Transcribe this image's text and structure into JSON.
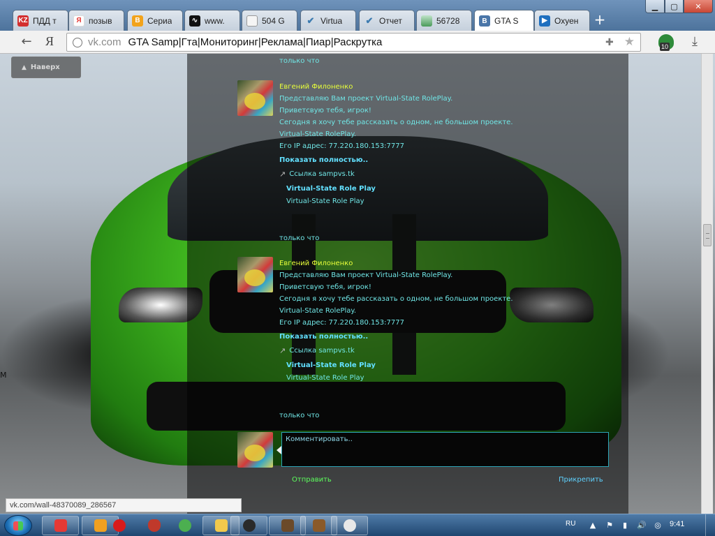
{
  "browser": {
    "tabs": [
      {
        "label": "ПДД т",
        "favicon": "kz-icon",
        "color": "#d32f2f"
      },
      {
        "label": "позыв",
        "favicon": "yandex-icon",
        "color": "#e53935"
      },
      {
        "label": "Сериа",
        "favicon": "b-icon",
        "color": "#f2a31b"
      },
      {
        "label": "www.",
        "favicon": "pulse-icon",
        "color": "#111111"
      },
      {
        "label": "504 G",
        "favicon": "page-icon",
        "color": "#9e9e9e"
      },
      {
        "label": "Virtua",
        "favicon": "v-check-icon",
        "color": "#3c7bb0"
      },
      {
        "label": "Отчет",
        "favicon": "v-check-icon",
        "color": "#3c7bb0"
      },
      {
        "label": "56728",
        "favicon": "image-icon",
        "color": "#4a9b5a"
      },
      {
        "label": "GTA S",
        "favicon": "vk-icon",
        "color": "#4a76a8",
        "active": true
      },
      {
        "label": "Охуен",
        "favicon": "play-icon",
        "color": "#1e6fbf"
      }
    ],
    "new_tab": "+",
    "address": {
      "domain": "vk.com",
      "title": "GTA Samp|Гта|Мониторинг|Реклама|Пиар|Раскрутка"
    },
    "extension_badge": "10",
    "status_url": "vk.com/wall-48370089_286567"
  },
  "page": {
    "scroll_top_label": "Наверх",
    "left_edge_char": "М",
    "posts": [
      {
        "author": "Евгений Филоненко",
        "lines": [
          "Представляю Вам проект Virtual-State RolePlay.",
          "Приветсвую тебя, игрок!",
          "Сегодня я хочу тебе рассказать о одном, не большом проекте.",
          "Virtual-State RolePlay.",
          "Его IP адрес: 77.220.180.153:7777"
        ],
        "show_more": "Показать полностью..",
        "link": "Ссылка sampvs.tk",
        "attachment_title": "Virtual-State Role Play",
        "attachment_sub": "Virtual-State Role Play",
        "timestamp": "только что"
      },
      {
        "author": "Евгений Филоненко",
        "lines": [
          "Представляю Вам проект Virtual-State RolePlay.",
          "Приветсвую тебя, игрок!",
          "Сегодня я хочу тебе рассказать о одном, не большом проекте.",
          "Virtual-State RolePlay.",
          "Его IP адрес: 77.220.180.153:7777"
        ],
        "show_more": "Показать полностью..",
        "link": "Ссылка sampvs.tk",
        "attachment_title": "Virtual-State Role Play",
        "attachment_sub": "Virtual-State Role Play",
        "timestamp": "только что"
      }
    ],
    "top_timestamp": "только что",
    "comment": {
      "placeholder": "Комментировать..",
      "send": "Отправить",
      "attach": "Прикрепить"
    }
  },
  "taskbar": {
    "apps": [
      {
        "name": "yandex-browser-icon",
        "color": "#e53935"
      },
      {
        "name": "media-player-icon",
        "color": "#f0a020"
      },
      {
        "name": "opera-icon",
        "color": "#d81b1b"
      },
      {
        "name": "money-bag-icon",
        "color": "#c0392b"
      },
      {
        "name": "icq-icon",
        "color": "#4caf50"
      },
      {
        "name": "explorer-icon",
        "color": "#f2c94c"
      },
      {
        "name": "steam-icon",
        "color": "#2a2a2a"
      },
      {
        "name": "game-icon",
        "color": "#6b4a2a"
      },
      {
        "name": "game-icon-2",
        "color": "#8a5a2a"
      },
      {
        "name": "paint-icon",
        "color": "#e8e8e8"
      }
    ],
    "language": "RU",
    "clock": "9:41"
  }
}
